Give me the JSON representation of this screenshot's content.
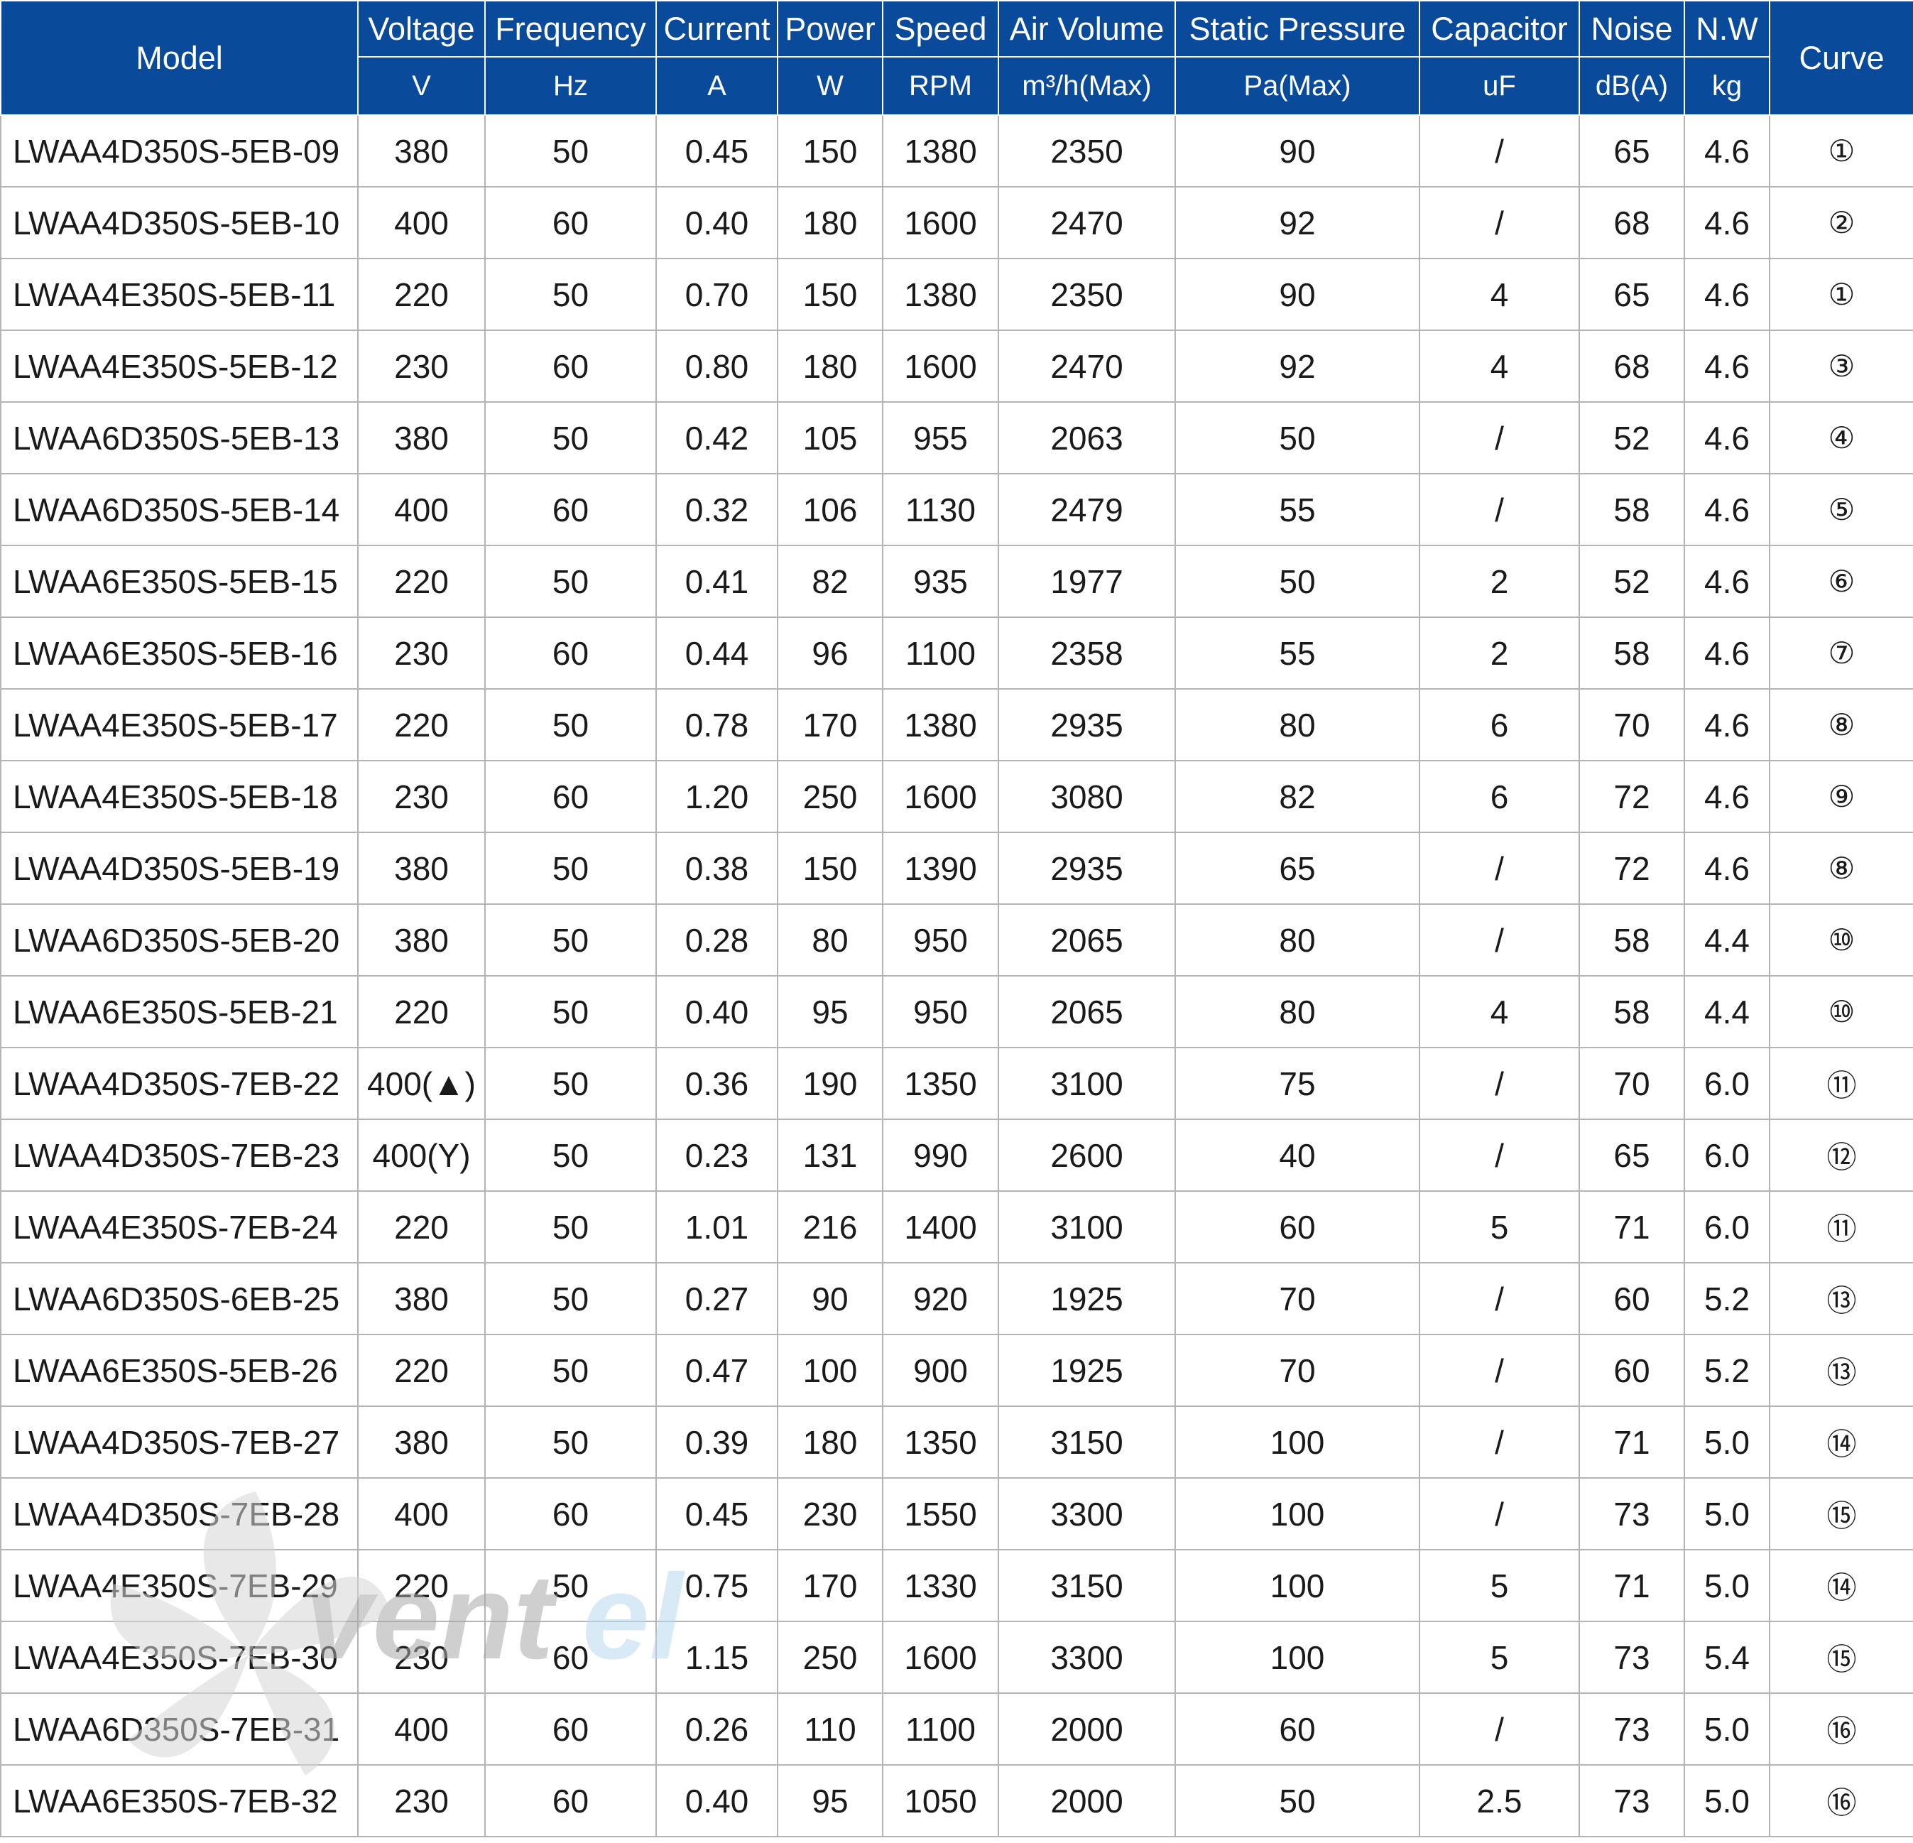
{
  "header": {
    "model": "Model",
    "curve": "Curve",
    "columns": [
      {
        "label": "Voltage",
        "unit": "V"
      },
      {
        "label": "Frequency",
        "unit": "Hz"
      },
      {
        "label": "Current",
        "unit": "A"
      },
      {
        "label": "Power",
        "unit": "W"
      },
      {
        "label": "Speed",
        "unit": "RPM"
      },
      {
        "label": "Air Volume",
        "unit": "m³/h(Max)"
      },
      {
        "label": "Static Pressure",
        "unit": "Pa(Max)"
      },
      {
        "label": "Capacitor",
        "unit": "uF"
      },
      {
        "label": "Noise",
        "unit": "dB(A)"
      },
      {
        "label": "N.W",
        "unit": "kg"
      }
    ]
  },
  "colors": {
    "header_bg": "#0a4a9b",
    "header_text": "#ffffff",
    "grid": "#b4b4b4"
  },
  "watermark": {
    "text": "ventel"
  },
  "rows": [
    [
      "LWAA4D350S-5EB-09",
      "380",
      "50",
      "0.45",
      "150",
      "1380",
      "2350",
      "90",
      "/",
      "65",
      "4.6",
      "①"
    ],
    [
      "LWAA4D350S-5EB-10",
      "400",
      "60",
      "0.40",
      "180",
      "1600",
      "2470",
      "92",
      "/",
      "68",
      "4.6",
      "②"
    ],
    [
      "LWAA4E350S-5EB-11",
      "220",
      "50",
      "0.70",
      "150",
      "1380",
      "2350",
      "90",
      "4",
      "65",
      "4.6",
      "①"
    ],
    [
      "LWAA4E350S-5EB-12",
      "230",
      "60",
      "0.80",
      "180",
      "1600",
      "2470",
      "92",
      "4",
      "68",
      "4.6",
      "③"
    ],
    [
      "LWAA6D350S-5EB-13",
      "380",
      "50",
      "0.42",
      "105",
      "955",
      "2063",
      "50",
      "/",
      "52",
      "4.6",
      "④"
    ],
    [
      "LWAA6D350S-5EB-14",
      "400",
      "60",
      "0.32",
      "106",
      "1130",
      "2479",
      "55",
      "/",
      "58",
      "4.6",
      "⑤"
    ],
    [
      "LWAA6E350S-5EB-15",
      "220",
      "50",
      "0.41",
      "82",
      "935",
      "1977",
      "50",
      "2",
      "52",
      "4.6",
      "⑥"
    ],
    [
      "LWAA6E350S-5EB-16",
      "230",
      "60",
      "0.44",
      "96",
      "1100",
      "2358",
      "55",
      "2",
      "58",
      "4.6",
      "⑦"
    ],
    [
      "LWAA4E350S-5EB-17",
      "220",
      "50",
      "0.78",
      "170",
      "1380",
      "2935",
      "80",
      "6",
      "70",
      "4.6",
      "⑧"
    ],
    [
      "LWAA4E350S-5EB-18",
      "230",
      "60",
      "1.20",
      "250",
      "1600",
      "3080",
      "82",
      "6",
      "72",
      "4.6",
      "⑨"
    ],
    [
      "LWAA4D350S-5EB-19",
      "380",
      "50",
      "0.38",
      "150",
      "1390",
      "2935",
      "65",
      "/",
      "72",
      "4.6",
      "⑧"
    ],
    [
      "LWAA6D350S-5EB-20",
      "380",
      "50",
      "0.28",
      "80",
      "950",
      "2065",
      "80",
      "/",
      "58",
      "4.4",
      "⑩"
    ],
    [
      "LWAA6E350S-5EB-21",
      "220",
      "50",
      "0.40",
      "95",
      "950",
      "2065",
      "80",
      "4",
      "58",
      "4.4",
      "⑩"
    ],
    [
      "LWAA4D350S-7EB-22",
      "400(▲)",
      "50",
      "0.36",
      "190",
      "1350",
      "3100",
      "75",
      "/",
      "70",
      "6.0",
      "⑪"
    ],
    [
      "LWAA4D350S-7EB-23",
      "400(Y)",
      "50",
      "0.23",
      "131",
      "990",
      "2600",
      "40",
      "/",
      "65",
      "6.0",
      "⑫"
    ],
    [
      "LWAA4E350S-7EB-24",
      "220",
      "50",
      "1.01",
      "216",
      "1400",
      "3100",
      "60",
      "5",
      "71",
      "6.0",
      "⑪"
    ],
    [
      "LWAA6D350S-6EB-25",
      "380",
      "50",
      "0.27",
      "90",
      "920",
      "1925",
      "70",
      "/",
      "60",
      "5.2",
      "⑬"
    ],
    [
      "LWAA6E350S-5EB-26",
      "220",
      "50",
      "0.47",
      "100",
      "900",
      "1925",
      "70",
      "/",
      "60",
      "5.2",
      "⑬"
    ],
    [
      "LWAA4D350S-7EB-27",
      "380",
      "50",
      "0.39",
      "180",
      "1350",
      "3150",
      "100",
      "/",
      "71",
      "5.0",
      "⑭"
    ],
    [
      "LWAA4D350S-7EB-28",
      "400",
      "60",
      "0.45",
      "230",
      "1550",
      "3300",
      "100",
      "/",
      "73",
      "5.0",
      "⑮"
    ],
    [
      "LWAA4E350S-7EB-29",
      "220",
      "50",
      "0.75",
      "170",
      "1330",
      "3150",
      "100",
      "5",
      "71",
      "5.0",
      "⑭"
    ],
    [
      "LWAA4E350S-7EB-30",
      "230",
      "60",
      "1.15",
      "250",
      "1600",
      "3300",
      "100",
      "5",
      "73",
      "5.4",
      "⑮"
    ],
    [
      "LWAA6D350S-7EB-31",
      "400",
      "60",
      "0.26",
      "110",
      "1100",
      "2000",
      "60",
      "/",
      "73",
      "5.0",
      "⑯"
    ],
    [
      "LWAA6E350S-7EB-32",
      "230",
      "60",
      "0.40",
      "95",
      "1050",
      "2000",
      "50",
      "2.5",
      "73",
      "5.0",
      "⑯"
    ]
  ]
}
